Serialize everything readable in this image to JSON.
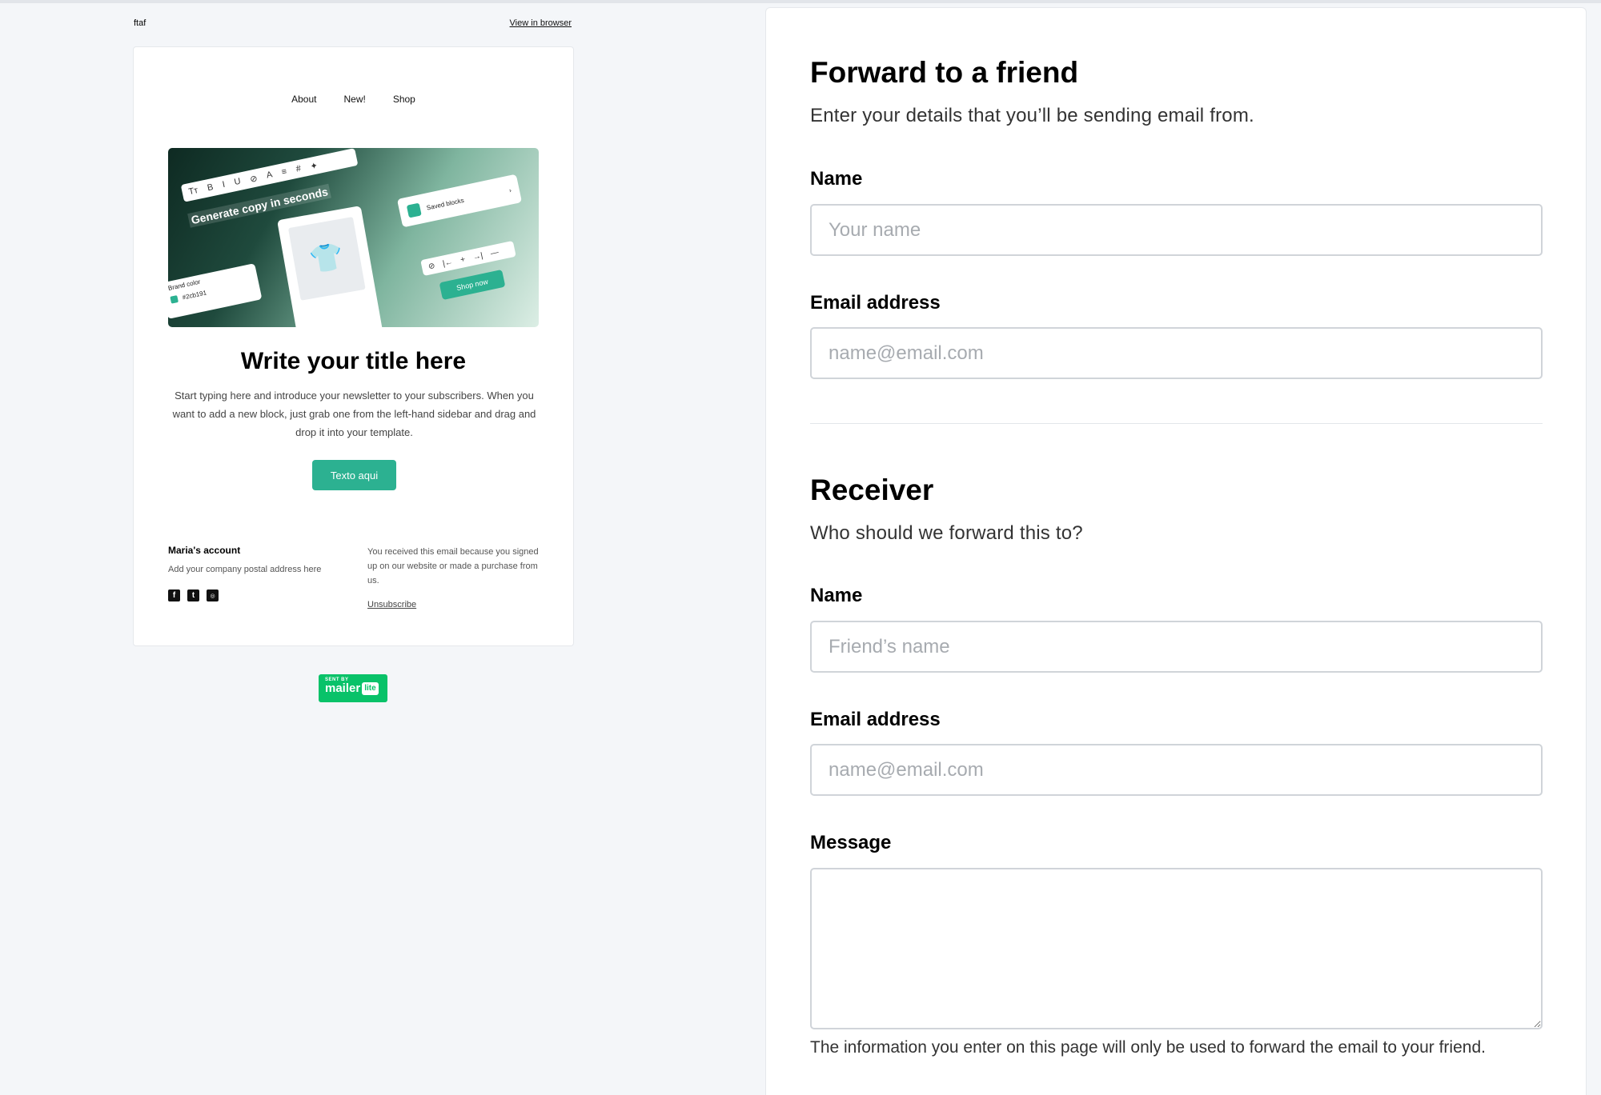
{
  "email": {
    "top_label": "ftaf",
    "view_in_browser": "View in browser",
    "nav": [
      "About",
      "New!",
      "Shop"
    ],
    "hero": {
      "toolbar": [
        "Tт",
        "B",
        "I",
        "U",
        "⊘",
        "A",
        "≡",
        "#",
        "✦"
      ],
      "generate_text": "Generate copy in seconds",
      "brand_label": "Brand color",
      "brand_value": "#2cb191",
      "saved_blocks": "Saved blocks",
      "saved_chevron": "›",
      "toolbar2": [
        "⊘",
        "|←",
        "+",
        "→|",
        "—"
      ],
      "shop_now": "Shop now"
    },
    "title": "Write your title here",
    "body": "Start typing here and introduce your newsletter to your subscribers. When you want to add a new block, just grab one from the left-hand sidebar and drag and drop it into your template.",
    "button": "Texto aqui",
    "footer": {
      "account": "Maria's account",
      "address": "Add your company postal address here",
      "social": [
        "f",
        "t",
        "ig"
      ],
      "reason": "You received this email because you signed up on our website or made a purchase from us.",
      "unsubscribe": "Unsubscribe"
    },
    "badge": {
      "sent_by": "SENT BY",
      "name": "mailer",
      "lite": "lite"
    }
  },
  "form": {
    "sender": {
      "title": "Forward to a friend",
      "subtitle": "Enter your details that you’ll be sending email from.",
      "name_label": "Name",
      "name_placeholder": "Your name",
      "email_label": "Email address",
      "email_placeholder": "name@email.com"
    },
    "receiver": {
      "title": "Receiver",
      "subtitle": "Who should we forward this to?",
      "name_label": "Name",
      "name_placeholder": "Friend’s name",
      "email_label": "Email address",
      "email_placeholder": "name@email.com",
      "message_label": "Message"
    },
    "note": "The information you enter on this page will only be used to forward the email to your friend."
  },
  "colors": {
    "accent": "#2cb191",
    "mailerlite": "#09c269",
    "page_bg": "#f4f6f9"
  }
}
